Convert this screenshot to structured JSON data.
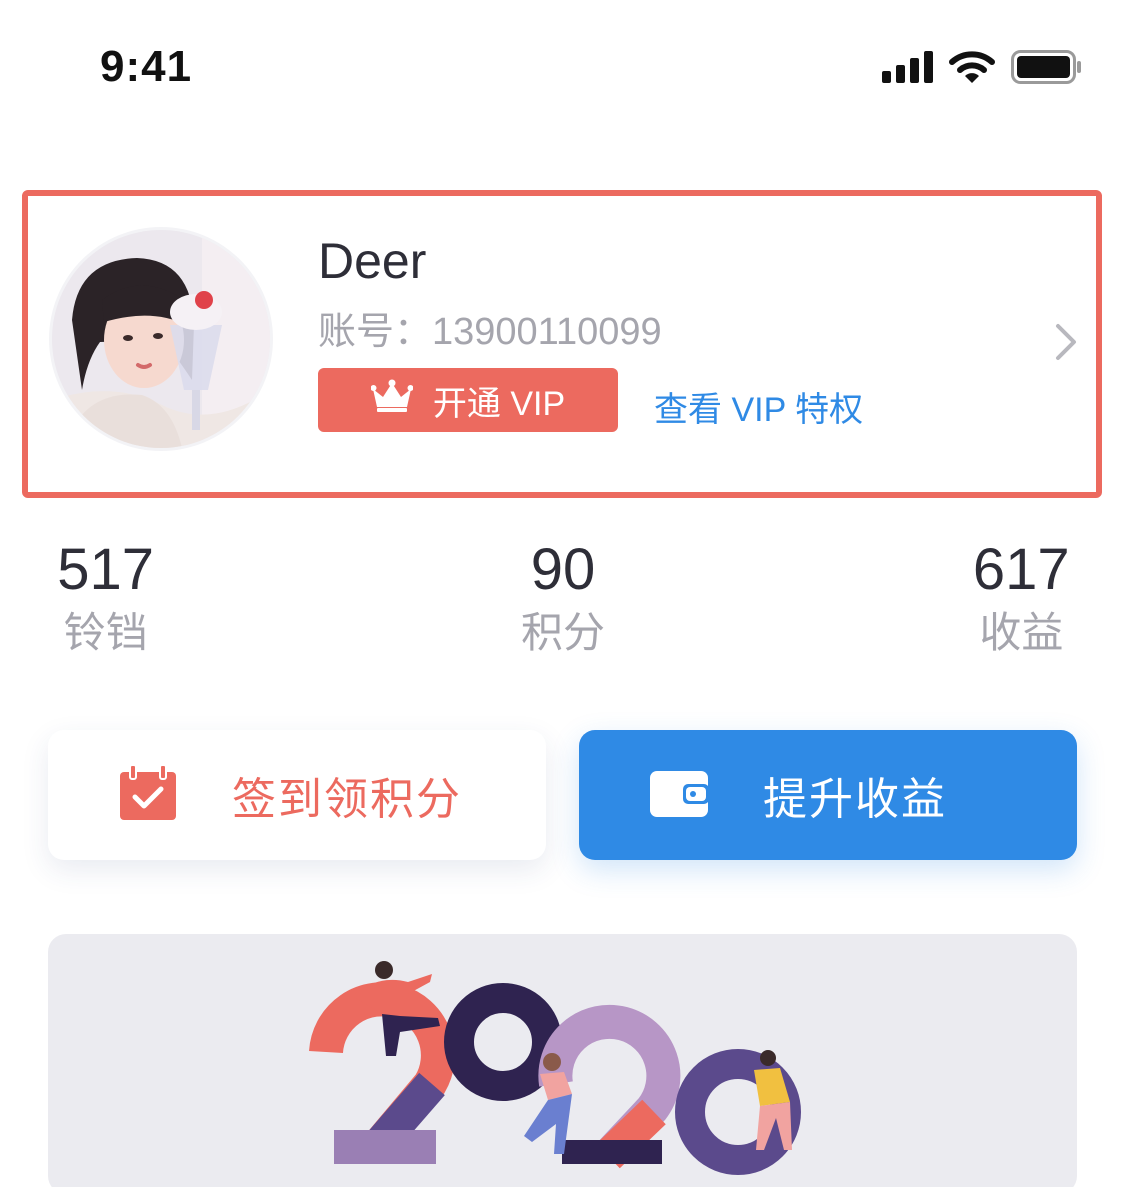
{
  "status_bar": {
    "time": "9:41"
  },
  "profile": {
    "name": "Deer",
    "account_label": "账号：",
    "account_number": "13900110099",
    "vip_button": "开通 VIP",
    "vip_link": "查看 VIP 特权"
  },
  "stats": [
    {
      "value": "517",
      "label": "铃铛"
    },
    {
      "value": "90",
      "label": "积分"
    },
    {
      "value": "617",
      "label": "收益"
    }
  ],
  "actions": {
    "checkin_label": "签到领积分",
    "earn_label": "提升收益"
  },
  "colors": {
    "accent_red": "#ec6a5f",
    "accent_blue": "#2f8ae5",
    "text_dark": "#2e2e38",
    "text_gray": "#a5a5ad",
    "banner_bg": "#ebebf0"
  },
  "icons": {
    "signal": "cellular-signal-icon",
    "wifi": "wifi-icon",
    "battery": "battery-icon",
    "crown": "crown-icon",
    "chevron": "chevron-right-icon",
    "calendar": "calendar-check-icon",
    "wallet": "wallet-icon"
  }
}
